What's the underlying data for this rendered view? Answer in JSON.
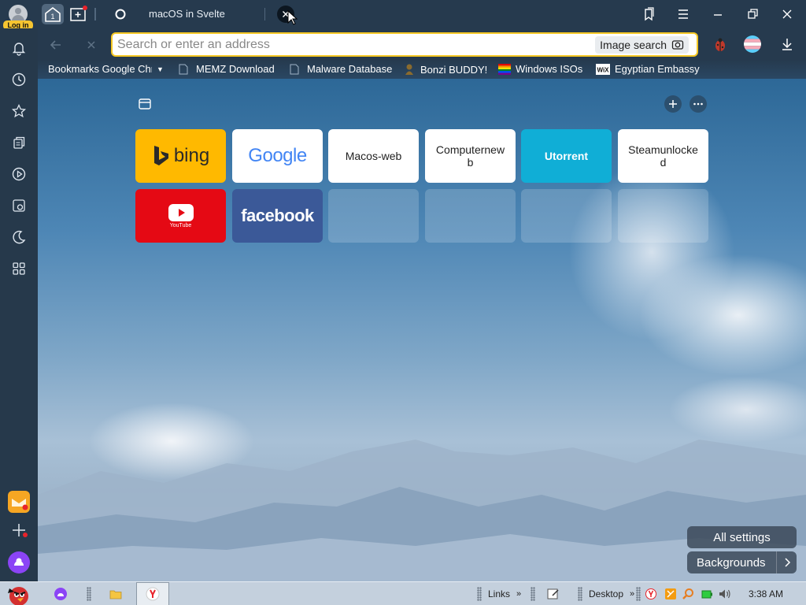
{
  "profile": {
    "login_label": "Log in"
  },
  "tabs": {
    "group_count": "1",
    "active_title": "macOS in Svelte"
  },
  "address": {
    "placeholder": "Search or enter an address",
    "image_search_label": "Image search"
  },
  "bookmarks": [
    {
      "label": "Bookmarks Google Chr"
    },
    {
      "label": "MEMZ Download"
    },
    {
      "label": "Malware Database"
    },
    {
      "label": "Bonzi BUDDY!"
    },
    {
      "label": "Windows ISOs"
    },
    {
      "label": "Egyptian Embassy"
    }
  ],
  "tiles": [
    {
      "label": "bing",
      "color": "#ffb900"
    },
    {
      "label": "Google",
      "color": "#ffffff"
    },
    {
      "label": "Macos-web"
    },
    {
      "label": "Computernew b"
    },
    {
      "label": "Utorrent",
      "color": "#10aed6"
    },
    {
      "label": "Steamunlocke d"
    },
    {
      "label": "YouTube",
      "color": "#e50914"
    },
    {
      "label": "facebook",
      "color": "#3b5998"
    }
  ],
  "buttons": {
    "all_settings": "All settings",
    "backgrounds": "Backgrounds"
  },
  "taskbar": {
    "links_label": "Links",
    "desktop_label": "Desktop",
    "time": "3:38 AM"
  },
  "colors": {
    "accent": "#f5c723",
    "sidebar": "#26394b",
    "taskbar": "#c4d0dd"
  }
}
